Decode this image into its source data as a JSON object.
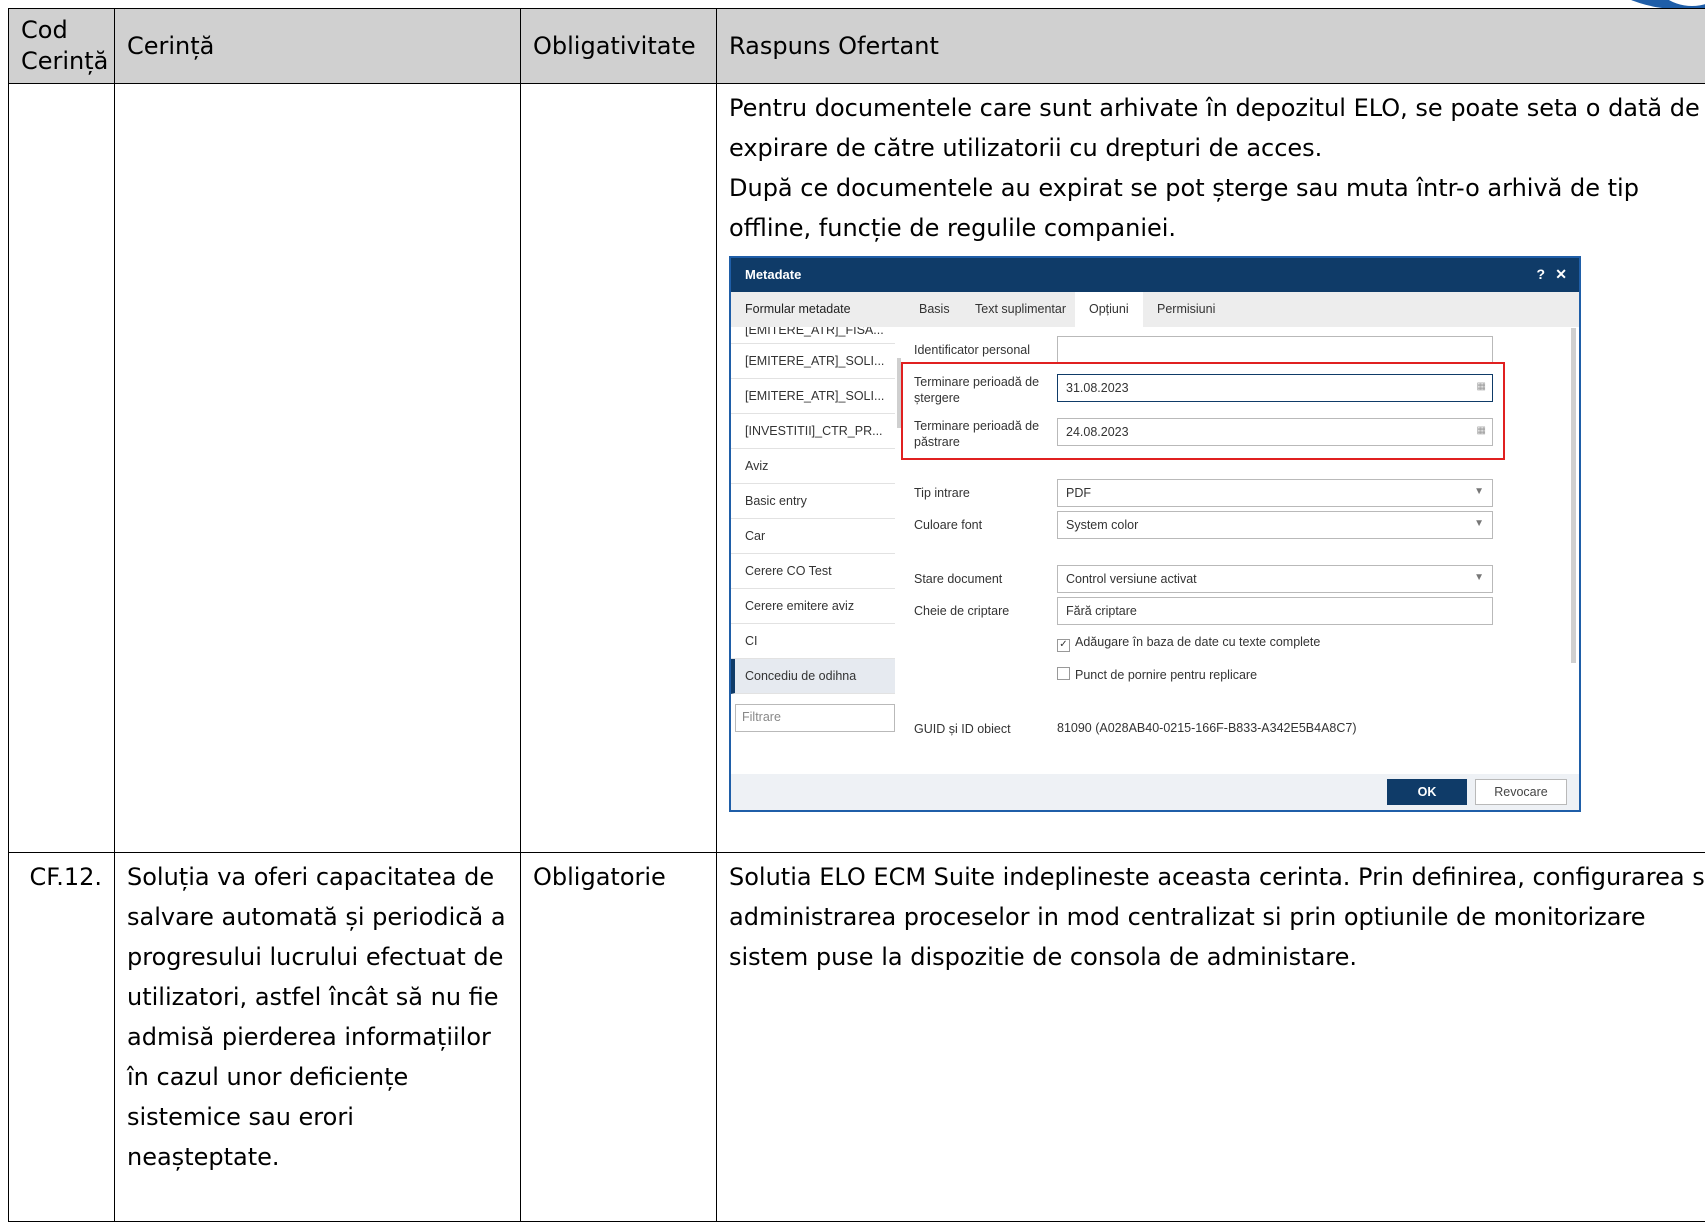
{
  "table": {
    "headers": [
      "Cod Cerință",
      "Cerință",
      "Obligativitate",
      "Raspuns Ofertant"
    ],
    "row1": {
      "code": "",
      "requirement": "",
      "obligation": "",
      "response_p1": "Pentru documentele care sunt arhivate în depozitul ELO, se poate seta o dată de expirare de către utilizatorii cu drepturi de acces.",
      "response_p2": "După ce documentele au expirat se pot șterge sau muta într-o arhivă de tip offline, funcție de regulile companiei."
    },
    "row2": {
      "code": "CF.12.",
      "requirement": "Soluția va oferi capacitatea de salvare automată și periodică a progresului lucrului efectuat de utilizatori, astfel încât să nu fie admisă pierderea informațiilor în cazul unor deficiențe sistemice sau erori neașteptate.",
      "obligation": "Obligatorie",
      "response": "Solutia ELO ECM Suite indeplineste aceasta cerinta. Prin definirea, configurarea si administrarea proceselor in mod centralizat si prin optiunile de monitorizare sistem puse la dispozitie de consola de administare."
    }
  },
  "dialog": {
    "title": "Metadate",
    "help_label": "?",
    "close_label": "✕",
    "left_header": "Formular metadate",
    "tabs": [
      "Basis",
      "Text suplimentar",
      "Opțiuni",
      "Permisiuni"
    ],
    "list_items": [
      "[EMITERE_ATR]_FISA...",
      "[EMITERE_ATR]_SOLI...",
      "[EMITERE_ATR]_SOLI...",
      "[INVESTITII]_CTR_PR...",
      "Aviz",
      "Basic entry",
      "Car",
      "Cerere CO Test",
      "Cerere emitere aviz",
      "CI",
      "Concediu de odihna"
    ],
    "filter_placeholder": "Filtrare",
    "fields": {
      "personal_id_label": "Identificator personal",
      "personal_id_value": "",
      "delete_period_label": "Terminare perioadă de ștergere",
      "delete_period_value": "31.08.2023",
      "retention_period_label": "Terminare perioadă de păstrare",
      "retention_period_value": "24.08.2023",
      "entry_type_label": "Tip intrare",
      "entry_type_value": "PDF",
      "font_color_label": "Culoare font",
      "font_color_value": "System color",
      "doc_state_label": "Stare document",
      "doc_state_value": "Control versiune activat",
      "encryption_key_label": "Cheie de criptare",
      "encryption_key_value": "Fără criptare",
      "fulltext_checkbox": "Adăugare în baza de date cu texte complete",
      "fulltext_checked": true,
      "replication_checkbox": "Punct de pornire pentru replicare",
      "replication_checked": false,
      "guid_label": "GUID și ID obiect",
      "guid_value": "81090 (A028AB40-0215-166F-B833-A342E5B4A8C7)"
    },
    "ok_label": "OK",
    "cancel_label": "Revocare",
    "colors": {
      "title_bar": "#0f3b68",
      "highlight": "#e02020",
      "border": "#1f5ea8"
    }
  }
}
